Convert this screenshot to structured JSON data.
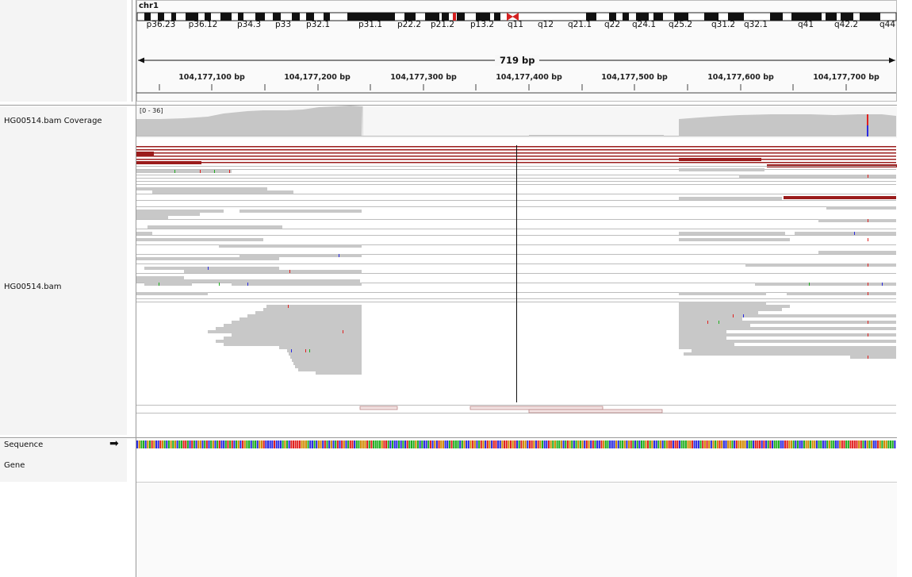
{
  "header": {
    "chromosome": "chr1",
    "cytobands": [
      "p36.23",
      "p36.12",
      "p34.3",
      "p33",
      "p32.1",
      "p31.1",
      "p22.2",
      "p21.2",
      "p13.2",
      "q11",
      "q12",
      "q21.1",
      "q22",
      "q24.1",
      "q25.2",
      "q31.2",
      "q32.1",
      "q41",
      "q42.2",
      "q44"
    ],
    "span_label": "719 bp",
    "ruler_ticks": [
      "104,177,100 bp",
      "104,177,200 bp",
      "104,177,300 bp",
      "104,177,400 bp",
      "104,177,500 bp",
      "104,177,600 bp",
      "104,177,700 bp"
    ]
  },
  "tracks": {
    "coverage_name": "HG00514.bam Coverage",
    "coverage_range": "[0 - 36]",
    "alignment_name": "HG00514.bam",
    "sequence_name": "Sequence",
    "gene_name": "Gene",
    "strand_arrow": "➡"
  },
  "colors": {
    "read_gray": "#c8c8c8",
    "discordant_red": "#9b1c1c",
    "mismatch_red": "#e0201e",
    "mismatch_green": "#1fae1f",
    "mismatch_blue": "#2a2ae0",
    "centromere_red": "#d42020"
  }
}
